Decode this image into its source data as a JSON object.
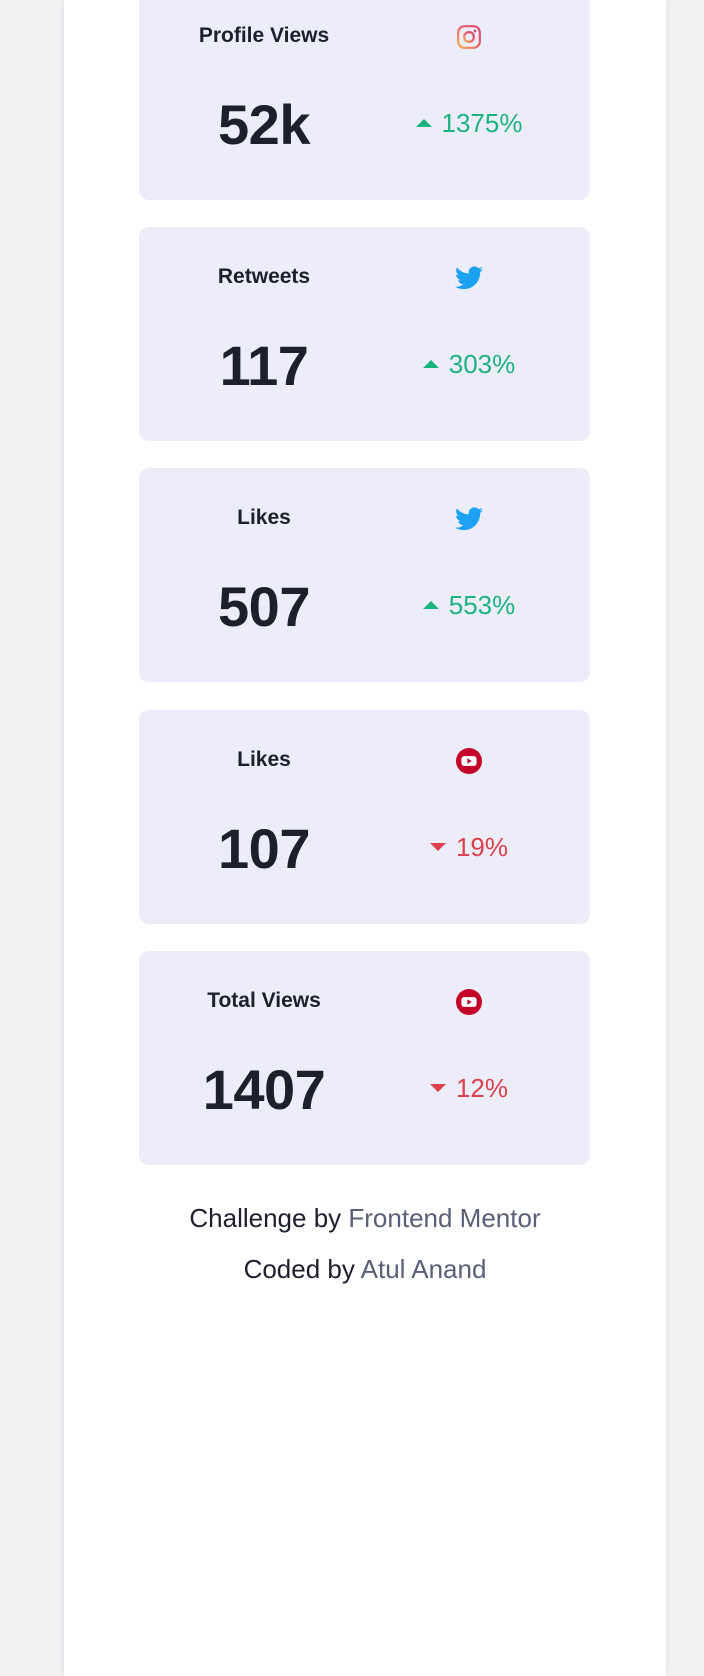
{
  "cards": [
    {
      "label": "Profile Views",
      "icon": "instagram-icon",
      "value": "52k",
      "change": "1375%",
      "trend": "up"
    },
    {
      "label": "Retweets",
      "icon": "twitter-icon",
      "value": "117",
      "change": "303%",
      "trend": "up"
    },
    {
      "label": "Likes",
      "icon": "twitter-icon",
      "value": "507",
      "change": "553%",
      "trend": "up"
    },
    {
      "label": "Likes",
      "icon": "youtube-icon",
      "value": "107",
      "change": "19%",
      "trend": "down"
    },
    {
      "label": "Total Views",
      "icon": "youtube-icon",
      "value": "1407",
      "change": "12%",
      "trend": "down"
    }
  ],
  "footer": {
    "challenge_prefix": "Challenge by ",
    "challenge_link": "Frontend Mentor",
    "coded_prefix": "Coded by ",
    "coded_link": "Atul Anand"
  },
  "colors": {
    "up": "#1eb482",
    "down": "#dc414c",
    "twitter": "#1da1f2",
    "youtube": "#c4032b",
    "card_bg": "#ecedf8"
  }
}
